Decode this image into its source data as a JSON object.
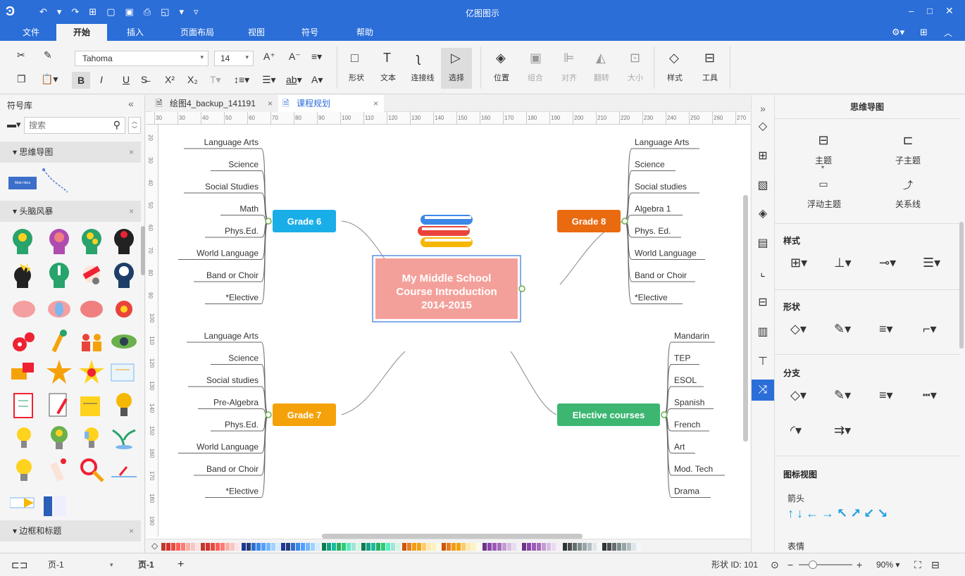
{
  "app": {
    "title": "亿图图示"
  },
  "quick_icons": [
    "logo-icon",
    "undo-icon",
    "redo-icon",
    "new-icon",
    "open-icon",
    "save-icon",
    "print-icon",
    "export-icon",
    "more-icon"
  ],
  "menu": [
    "文件",
    "开始",
    "插入",
    "页面布局",
    "视图",
    "符号",
    "帮助"
  ],
  "ribbon": {
    "font_name": "Tahoma",
    "font_size": "14",
    "shape": "形状",
    "text": "文本",
    "connector": "连接线",
    "select": "选择",
    "position": "位置",
    "group": "组合",
    "align": "对齐",
    "flip": "翻转",
    "size": "大小",
    "style": "样式",
    "tools": "工具"
  },
  "left_panel": {
    "title": "符号库",
    "search_placeholder": "搜索",
    "section1": "思维导图",
    "section2": "头脑风暴",
    "section3": "边框和标题",
    "thumb_text": "Main Idea"
  },
  "tabs": [
    {
      "label": "绘图4_backup_141191"
    },
    {
      "label": "课程规划"
    }
  ],
  "ruler_h": [
    "30",
    "30",
    "40",
    "50",
    "60",
    "70",
    "80",
    "90",
    "100",
    "110",
    "120",
    "130",
    "140",
    "150",
    "160",
    "170",
    "180",
    "190",
    "200",
    "210",
    "220",
    "230",
    "240",
    "250",
    "260",
    "270"
  ],
  "ruler_v": [
    "20",
    "30",
    "40",
    "50",
    "60",
    "70",
    "80",
    "90",
    "100",
    "110",
    "120",
    "130",
    "140",
    "150",
    "160",
    "170",
    "180",
    "190"
  ],
  "mindmap": {
    "center": [
      "My Middle School",
      "Course Introduction",
      "2014-2015"
    ],
    "grade6": {
      "label": "Grade 6",
      "items": [
        "Language Arts",
        "Science",
        "Social Studies",
        "Math",
        "Phys.Ed.",
        "World Language",
        "Band or Choir",
        "*Elective"
      ]
    },
    "grade7": {
      "label": "Grade 7",
      "items": [
        "Language Arts",
        "Science",
        "Social studies",
        "Pre-Algebra",
        "Phys.Ed.",
        "World Language",
        "Band or Choir",
        "*Elective"
      ]
    },
    "grade8": {
      "label": "Grade 8",
      "items": [
        "Language Arts",
        "Science",
        "Social studies",
        "Algebra 1",
        "Phys. Ed.",
        "World Language",
        "Band or Choir",
        "*Elective"
      ]
    },
    "elective": {
      "label": "Elective courses",
      "items": [
        "Mandarin",
        "TEP",
        "ESOL",
        "Spanish",
        "French",
        "Art",
        "Mod. Tech",
        "Drama"
      ]
    },
    "colors": {
      "grade6": "#1aaee8",
      "grade7": "#f5a20a",
      "grade8": "#ea6a10",
      "elective": "#3cb671",
      "center": "#f4a09a"
    }
  },
  "right_panel": {
    "title": "思维导图",
    "topic": "主题",
    "subtopic": "子主题",
    "float_topic": "浮动主题",
    "relation": "关系线",
    "style": "样式",
    "shape": "形状",
    "branch": "分支",
    "icon_view": "图标视图",
    "arrow": "箭头",
    "emotion": "表情"
  },
  "status": {
    "page_select": "页-1",
    "page_tab": "页-1",
    "add": "+",
    "shape_id": "形状 ID: 101",
    "zoom": "90%"
  }
}
